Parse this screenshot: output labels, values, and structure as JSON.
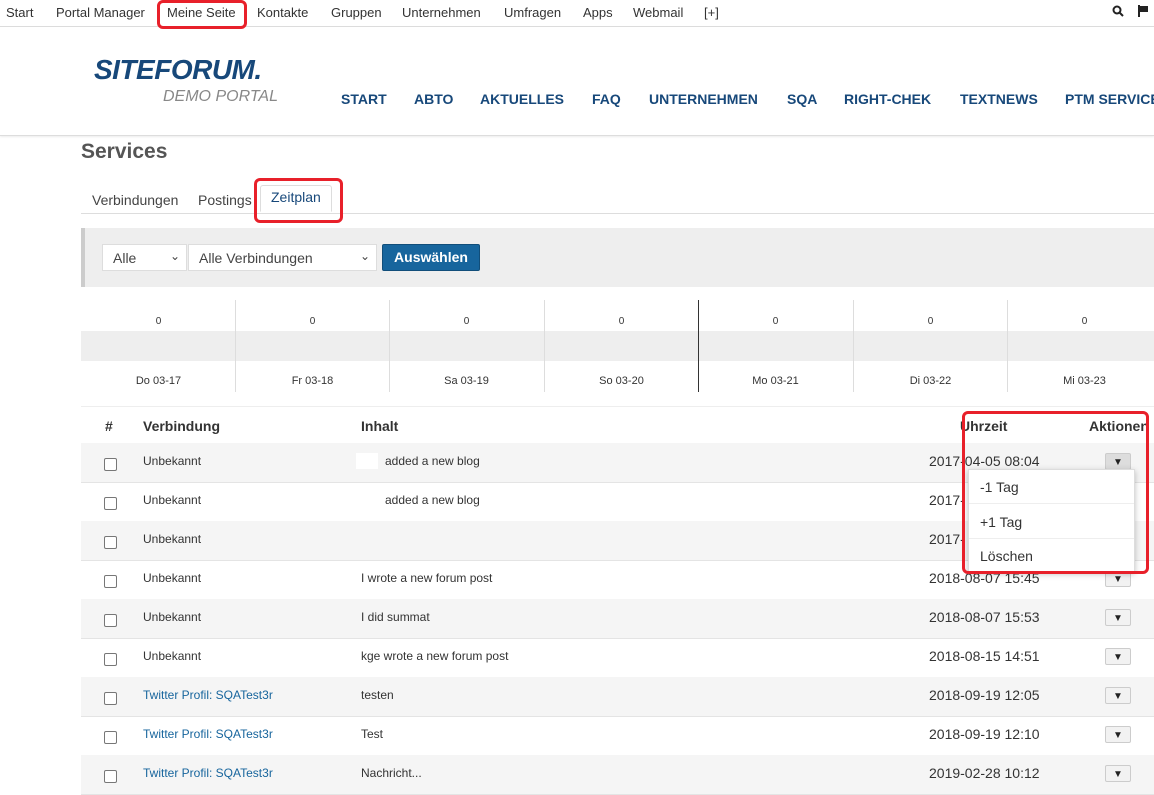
{
  "topnav": {
    "items": [
      "Start",
      "Portal Manager",
      "Meine Seite",
      "Kontakte",
      "Gruppen",
      "Unternehmen",
      "Umfragen",
      "Apps",
      "Webmail",
      "[+]"
    ],
    "icons": [
      "zoom-icon",
      "flag-icon"
    ]
  },
  "header": {
    "logo_main": "SITEFORUM.",
    "logo_sub": "DEMO PORTAL",
    "nav": [
      "START",
      "ABTO",
      "AKTUELLES",
      "FAQ",
      "UNTERNEHMEN",
      "SQA",
      "RIGHT-CHEK",
      "TEXTNEWS",
      "PTM SERVICE"
    ]
  },
  "page": {
    "title": "Services",
    "tabs": [
      "Verbindungen",
      "Postings",
      "Zeitplan"
    ],
    "active_tab": "Zeitplan"
  },
  "filter": {
    "select1": "Alle",
    "select2": "Alle Verbindungen",
    "button": "Auswählen"
  },
  "timeline": {
    "counts": [
      "0",
      "0",
      "0",
      "0",
      "0",
      "0",
      "0"
    ],
    "dates": [
      "Do 03-17",
      "Fr 03-18",
      "Sa 03-19",
      "So 03-20",
      "Mo 03-21",
      "Di 03-22",
      "Mi 03-23"
    ]
  },
  "table": {
    "headers": {
      "num": "#",
      "conn": "Verbindung",
      "content": "Inhalt",
      "time": "Uhrzeit",
      "actions": "Aktionen"
    },
    "rows": [
      {
        "conn": "Unbekannt",
        "content": "added a new blog",
        "time": "2017-04-05 08:04"
      },
      {
        "conn": "Unbekannt",
        "content": "added a new blog",
        "time": "2017-"
      },
      {
        "conn": "Unbekannt",
        "content": "",
        "time": "2017-"
      },
      {
        "conn": "Unbekannt",
        "content": "I wrote a new forum post",
        "time": "2018-08-07 15:45"
      },
      {
        "conn": "Unbekannt",
        "content": "I did summat",
        "time": "2018-08-07 15:53"
      },
      {
        "conn": "Unbekannt",
        "content": "kge wrote a new forum post",
        "time": "2018-08-15 14:51"
      },
      {
        "conn": "Twitter Profil: SQATest3r",
        "content": "testen",
        "time": "2018-09-19 12:05"
      },
      {
        "conn": "Twitter Profil: SQATest3r",
        "content": "Test",
        "time": "2018-09-19 12:10"
      },
      {
        "conn": "Twitter Profil: SQATest3r",
        "content": "Nachricht...",
        "time": "2019-02-28 10:12"
      }
    ]
  },
  "dropdown": {
    "items": [
      "-1 Tag",
      "+1 Tag",
      "Löschen"
    ]
  }
}
